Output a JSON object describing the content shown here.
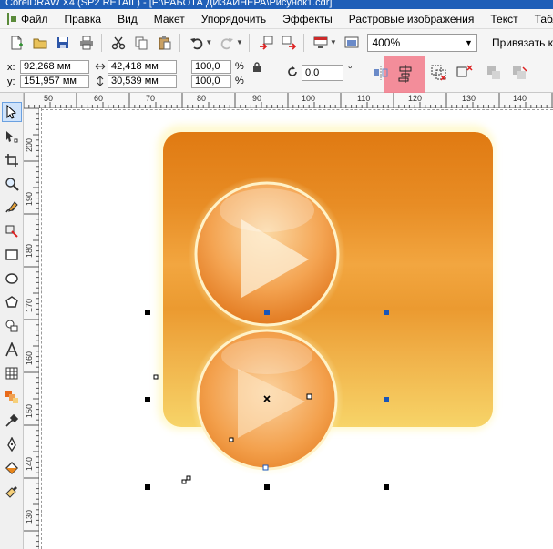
{
  "window": {
    "title": "CorelDRAW X4 (SP2 RETAIL) - [F:\\РАБОТА ДИЗАЙНЕРА\\Рисунок1.cdr]"
  },
  "menu": {
    "items": [
      "Файл",
      "Правка",
      "Вид",
      "Макет",
      "Упорядочить",
      "Эффекты",
      "Растровые изображения",
      "Текст",
      "Таблица"
    ]
  },
  "toolbar": {
    "zoom": "400%",
    "snap_label": "Привязать к"
  },
  "properties": {
    "x_label": "x:",
    "y_label": "y:",
    "x_value": "92,268 мм",
    "y_value": "151,957 мм",
    "width_value": "42,418 мм",
    "height_value": "30,539 мм",
    "scale_x": "100,0",
    "scale_y": "100,0",
    "percent": "%",
    "rotation": "0,0",
    "degree": "°"
  },
  "ruler": {
    "h_ticks": [
      "50",
      "60",
      "70",
      "80",
      "90",
      "100",
      "110",
      "120",
      "130",
      "140"
    ],
    "v_ticks": [
      "200",
      "190",
      "180",
      "170",
      "160",
      "150",
      "140",
      "130"
    ]
  },
  "colors": {
    "accent_highlight": "#f27a8a",
    "icon_orange": "#e8861c",
    "selection_blue": "#1a56b8"
  }
}
